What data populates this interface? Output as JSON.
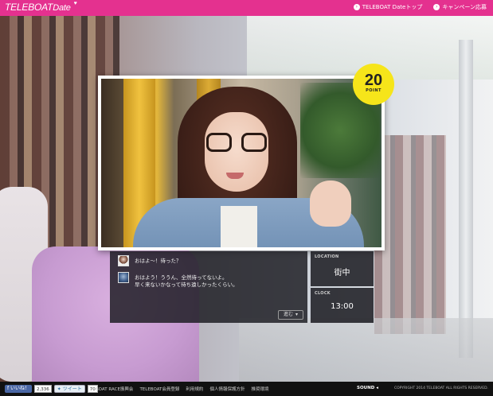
{
  "header": {
    "logo_main": "TELEBOAT",
    "logo_sub": "Date",
    "nav": [
      {
        "label": "TELEBOAT Dateトップ"
      },
      {
        "label": "キャンペーン応募"
      }
    ]
  },
  "badge": {
    "points": "20",
    "label": "POINT"
  },
  "chat": {
    "messages": [
      {
        "speaker": "girl",
        "text": "おはよ〜！待った？"
      },
      {
        "speaker": "boy",
        "text_line1": "おはよう！ううん、全然待ってないよ。",
        "text_line2": "早く来ないかなって待ち遠しかったくらい。"
      }
    ],
    "next_label": "進む"
  },
  "location": {
    "label": "LOCATION",
    "value": "街中"
  },
  "clock": {
    "label": "CLOCK",
    "value": "13:00"
  },
  "footer": {
    "fb_label": "いいね！",
    "fb_count": "2,336",
    "tw_label": "ツイート",
    "tw_count": "70",
    "links": [
      "BOAT RACE振興会",
      "TELEBOAT会員登録",
      "利用規約",
      "個人情報保護方針",
      "推奨環境"
    ],
    "sound": "SOUND",
    "copyright": "COPYRIGHT 2014 TELEBOAT ALL RIGHTS RESERVED."
  },
  "colors": {
    "brand": "#e4318f",
    "badge": "#f6e51a"
  }
}
